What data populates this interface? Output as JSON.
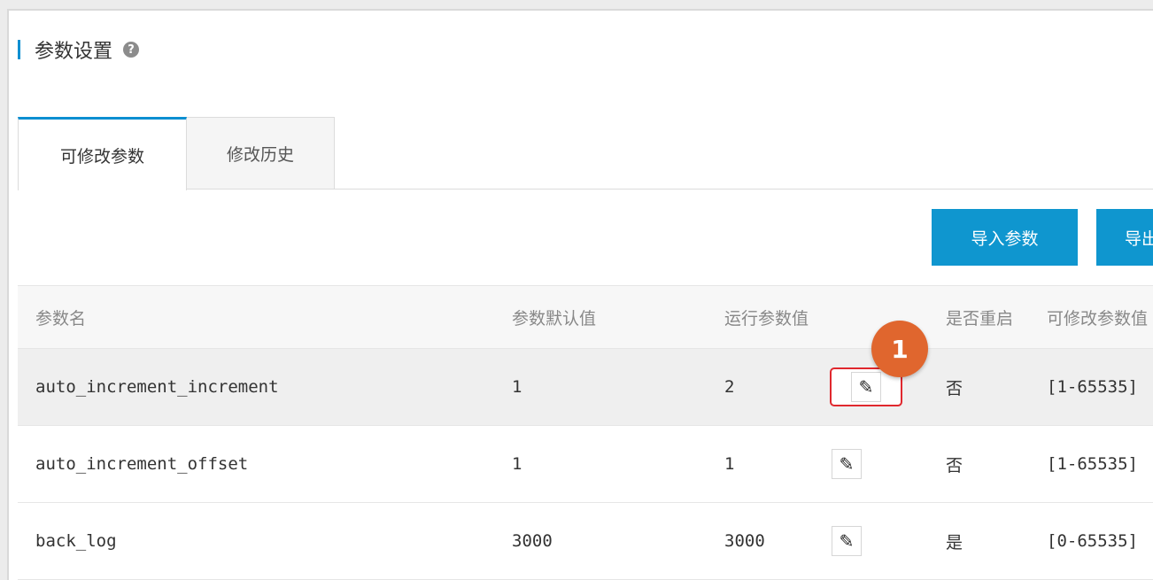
{
  "section": {
    "title": "参数设置",
    "help_icon": "question-circle-icon"
  },
  "tabs": [
    {
      "label": "可修改参数",
      "active": true
    },
    {
      "label": "修改历史",
      "active": false
    }
  ],
  "toolbar": {
    "import_label": "导入参数",
    "export_label": "导出参数"
  },
  "table": {
    "headers": [
      "参数名",
      "参数默认值",
      "运行参数值",
      "是否重启",
      "可修改参数值"
    ],
    "rows": [
      {
        "name": "auto_increment_increment",
        "default": "1",
        "running": "2",
        "restart": "否",
        "range": "[1-65535]"
      },
      {
        "name": "auto_increment_offset",
        "default": "1",
        "running": "1",
        "restart": "否",
        "range": "[1-65535]"
      },
      {
        "name": "back_log",
        "default": "3000",
        "running": "3000",
        "restart": "是",
        "range": "[0-65535]"
      }
    ]
  },
  "callout": {
    "label": "1"
  },
  "colors": {
    "accent": "#0b8fd1",
    "button": "#0f96cf",
    "callout": "#e0662e",
    "highlight": "#e0282e"
  },
  "icons": {
    "edit": "pencil-icon"
  }
}
